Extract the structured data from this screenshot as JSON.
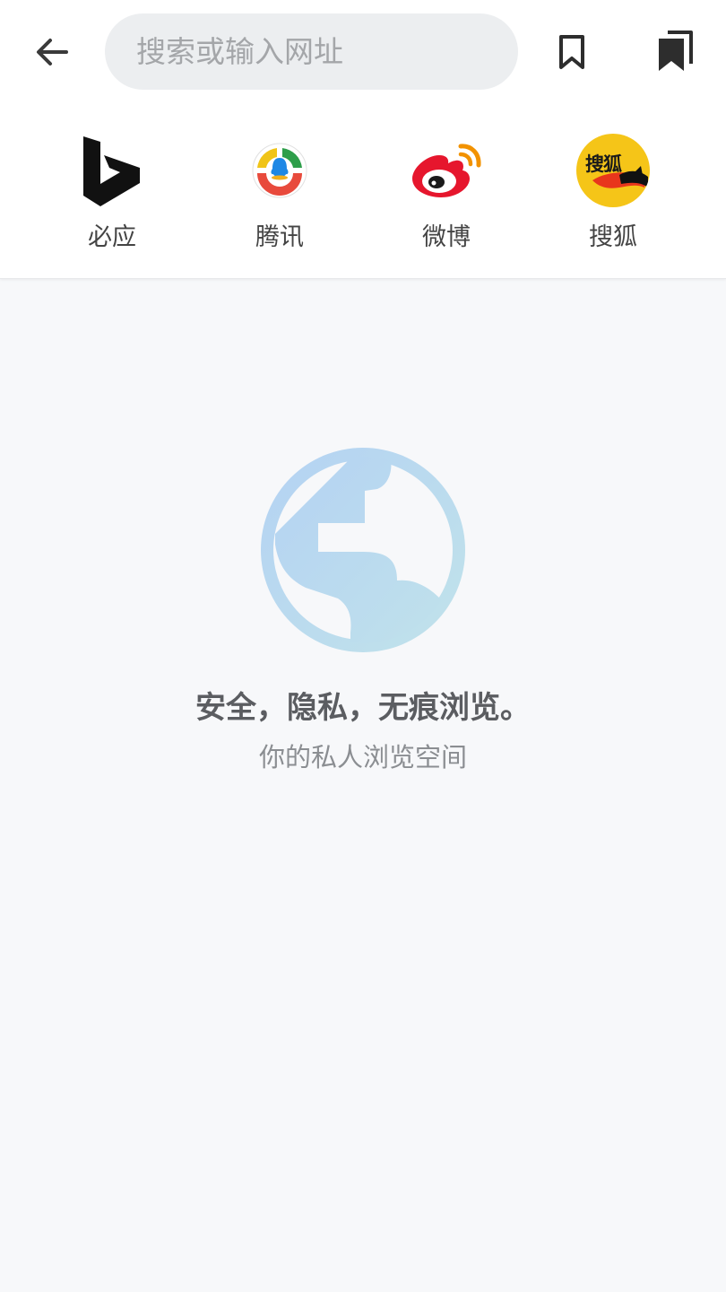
{
  "search": {
    "placeholder": "搜索或输入网址",
    "value": ""
  },
  "toolbar": {
    "back_icon": "arrow-left-icon",
    "bookmark_icon": "bookmark-outline-icon",
    "bookmarks_icon": "bookmarks-stack-icon"
  },
  "shortcuts": [
    {
      "label": "必应",
      "icon": "bing-logo"
    },
    {
      "label": "腾讯",
      "icon": "tencent-news-logo"
    },
    {
      "label": "微博",
      "icon": "weibo-logo"
    },
    {
      "label": "搜狐",
      "icon": "sohu-logo",
      "logo_text": "搜狐"
    }
  ],
  "private_mode": {
    "icon": "globe-icon",
    "headline": "安全，隐私，无痕浏览。",
    "subline": "你的私人浏览空间"
  },
  "colors": {
    "background": "#f7f8fa",
    "header_background": "#ffffff",
    "search_background": "#eceef0",
    "globe_blue": "#b9d6f2",
    "globe_teal": "#bfe1ea",
    "weibo_red": "#e6162d",
    "sohu_yellow": "#f5c518"
  }
}
